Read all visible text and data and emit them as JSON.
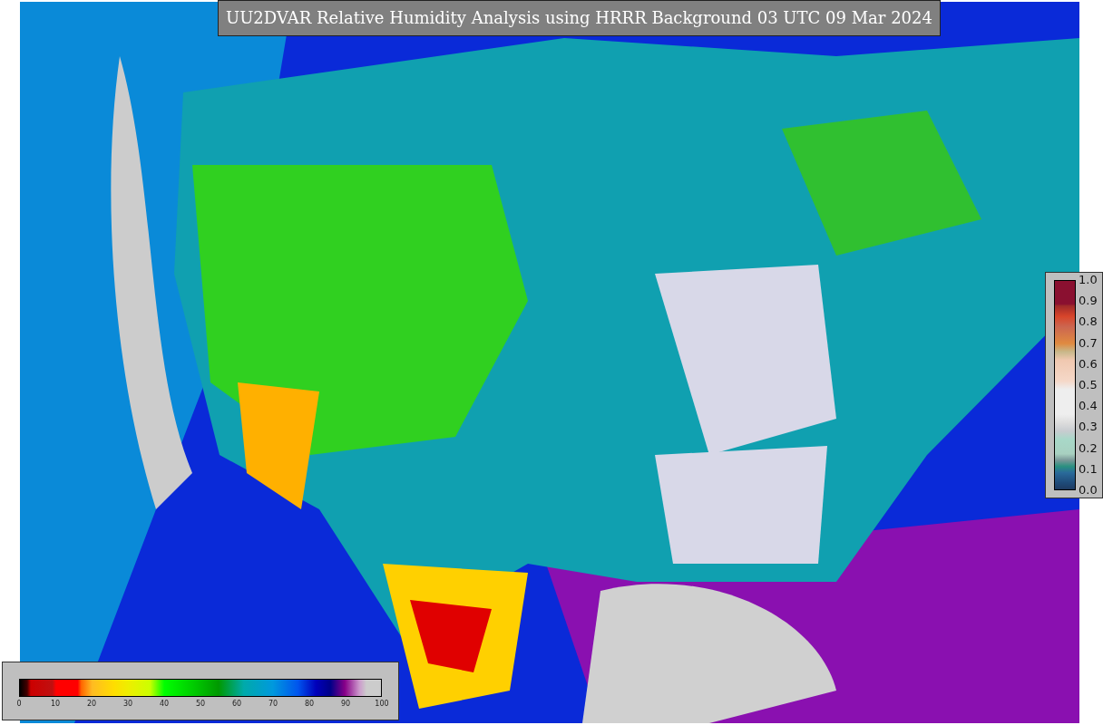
{
  "title": "UU2DVAR Relative Humidity Analysis using HRRR Background 03 UTC 09 Mar 2024",
  "humidity_colorbar": {
    "ticks": [
      "0",
      "10",
      "20",
      "30",
      "40",
      "50",
      "60",
      "70",
      "80",
      "90",
      "100"
    ]
  },
  "station_colorbar": {
    "ticks": [
      "1.0",
      "0.9",
      "0.8",
      "0.7",
      "0.6",
      "0.5",
      "0.4",
      "0.3",
      "0.2",
      "0.1",
      "0.0"
    ]
  }
}
